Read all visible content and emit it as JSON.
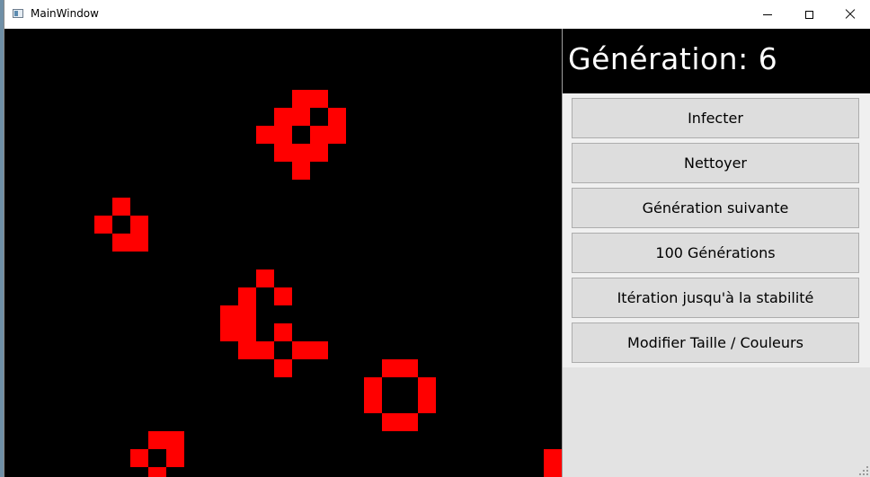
{
  "window": {
    "title": "MainWindow"
  },
  "colors": {
    "cell": "#ff0000",
    "grid_background": "#000000"
  },
  "icons": {
    "app": "app-icon",
    "minimize": "minimize-icon",
    "maximize": "maximize-icon",
    "close": "close-icon"
  },
  "grid": {
    "cell_color": "#ff0000",
    "live_cells": [
      [
        16,
        3
      ],
      [
        17,
        3
      ],
      [
        15,
        4
      ],
      [
        16,
        4
      ],
      [
        18,
        4
      ],
      [
        14,
        5
      ],
      [
        15,
        5
      ],
      [
        17,
        5
      ],
      [
        18,
        5
      ],
      [
        15,
        6
      ],
      [
        16,
        6
      ],
      [
        17,
        6
      ],
      [
        16,
        7
      ],
      [
        6,
        9
      ],
      [
        5,
        10
      ],
      [
        7,
        10
      ],
      [
        6,
        11
      ],
      [
        7,
        11
      ],
      [
        14,
        13
      ],
      [
        13,
        14
      ],
      [
        15,
        14
      ],
      [
        12,
        15
      ],
      [
        13,
        15
      ],
      [
        12,
        16
      ],
      [
        13,
        16
      ],
      [
        15,
        16
      ],
      [
        13,
        17
      ],
      [
        14,
        17
      ],
      [
        16,
        17
      ],
      [
        17,
        17
      ],
      [
        15,
        18
      ],
      [
        21,
        18
      ],
      [
        22,
        18
      ],
      [
        20,
        19
      ],
      [
        23,
        19
      ],
      [
        20,
        20
      ],
      [
        23,
        20
      ],
      [
        21,
        21
      ],
      [
        22,
        21
      ],
      [
        8,
        22
      ],
      [
        9,
        22
      ],
      [
        7,
        23
      ],
      [
        9,
        23
      ],
      [
        8,
        24
      ],
      [
        30,
        23
      ],
      [
        30,
        24
      ]
    ]
  },
  "panel": {
    "generation_text": "Génération: 6",
    "buttons": [
      {
        "label": "Infecter"
      },
      {
        "label": "Nettoyer"
      },
      {
        "label": "Génération suivante"
      },
      {
        "label": "100 Générations"
      },
      {
        "label": "Itération jusqu'à la stabilité"
      },
      {
        "label": "Modifier Taille / Couleurs"
      }
    ]
  }
}
